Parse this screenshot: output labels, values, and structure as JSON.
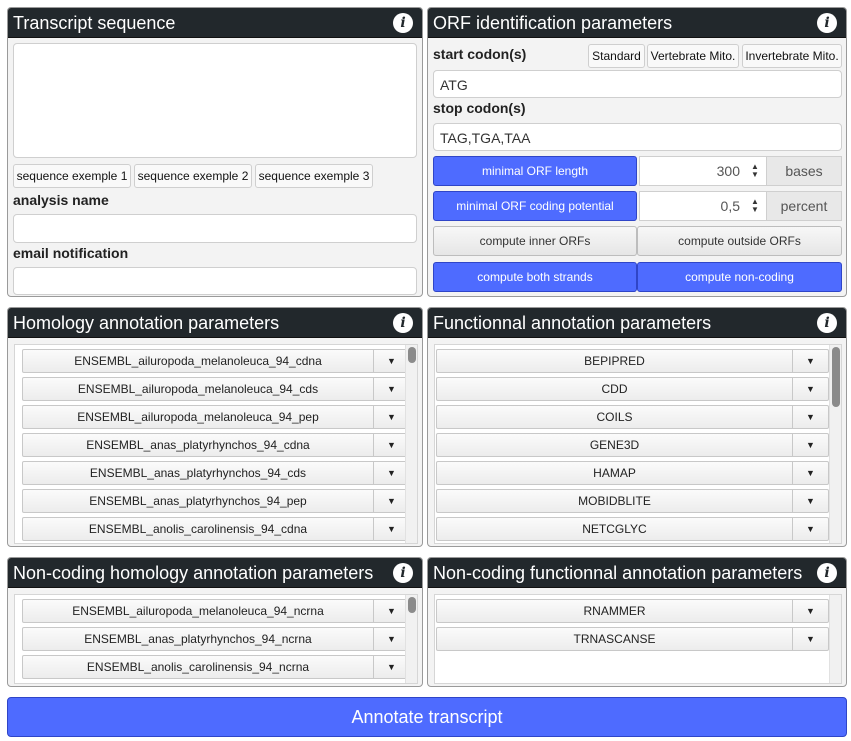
{
  "transcript_panel": {
    "title": "Transcript sequence",
    "sequence_value": "",
    "example_buttons": [
      "sequence exemple 1",
      "sequence exemple 2",
      "sequence exemple 3"
    ],
    "analysis_label": "analysis name",
    "analysis_value": "",
    "email_label": "email notification",
    "email_value": ""
  },
  "orf_panel": {
    "title": "ORF identification parameters",
    "start_label": "start codon(s)",
    "presets": [
      "Standard",
      "Vertebrate Mito.",
      "Invertebrate Mito."
    ],
    "start_value": "ATG",
    "stop_label": "stop codon(s)",
    "stop_value": "TAG,TGA,TAA",
    "min_length_label": "minimal ORF length",
    "min_length_value": "300",
    "min_length_unit": "bases",
    "min_coding_label": "minimal ORF coding potential",
    "min_coding_value": "0,5",
    "min_coding_unit": "percent",
    "inner_label": "compute inner ORFs",
    "outside_label": "compute outside ORFs",
    "both_strands_label": "compute both strands",
    "non_coding_label": "compute non-coding"
  },
  "homology_panel": {
    "title": "Homology annotation parameters",
    "items": [
      "ENSEMBL_ailuropoda_melanoleuca_94_cdna",
      "ENSEMBL_ailuropoda_melanoleuca_94_cds",
      "ENSEMBL_ailuropoda_melanoleuca_94_pep",
      "ENSEMBL_anas_platyrhynchos_94_cdna",
      "ENSEMBL_anas_platyrhynchos_94_cds",
      "ENSEMBL_anas_platyrhynchos_94_pep",
      "ENSEMBL_anolis_carolinensis_94_cdna"
    ]
  },
  "functional_panel": {
    "title": "Functionnal annotation parameters",
    "items": [
      "BEPIPRED",
      "CDD",
      "COILS",
      "GENE3D",
      "HAMAP",
      "MOBIDBLITE",
      "NETCGLYC"
    ]
  },
  "nc_homology_panel": {
    "title": "Non-coding homology annotation parameters",
    "items": [
      "ENSEMBL_ailuropoda_melanoleuca_94_ncrna",
      "ENSEMBL_anas_platyrhynchos_94_ncrna",
      "ENSEMBL_anolis_carolinensis_94_ncrna"
    ]
  },
  "nc_functional_panel": {
    "title": "Non-coding functionnal annotation parameters",
    "items": [
      "RNAMMER",
      "TRNASCANSE"
    ]
  },
  "info_glyph": "i",
  "caret_glyph": "▼",
  "annotate_label": "Annotate transcript",
  "colors": {
    "header_bg": "#22282c",
    "accent_blue": "#4e6bff",
    "panel_bg": "#f3f3f3"
  }
}
